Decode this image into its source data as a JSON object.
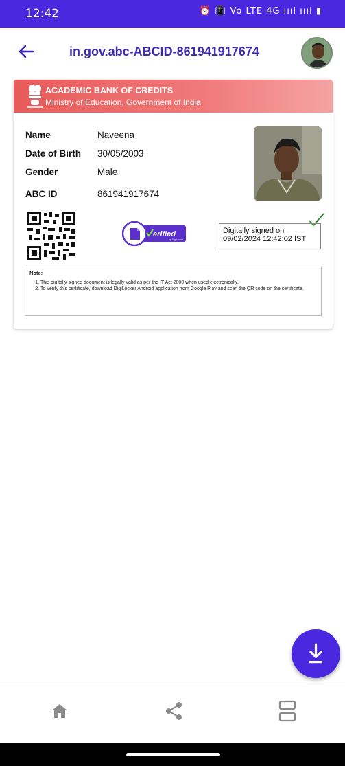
{
  "status_bar": {
    "time": "12:42",
    "indicators": "⏰ 📳 Vo LTE 4G ıııl ıııl ▮"
  },
  "app_bar": {
    "title": "in.gov.abc-ABCID-861941917674",
    "back_icon": "back-arrow-icon",
    "avatar_icon": "avatar"
  },
  "card": {
    "header_title": "ACADEMIC BANK OF CREDITS",
    "header_subtitle": "Ministry of Education, Government of India",
    "header_color": "#e85a5a",
    "fields": [
      {
        "label": "Name",
        "value": "Naveena"
      },
      {
        "label": "Date of Birth",
        "value": "30/05/2003"
      },
      {
        "label": "Gender",
        "value": "Male"
      },
      {
        "label": "ABC ID",
        "value": "861941917674"
      }
    ],
    "verified_label": "erified",
    "verified_sub": "by DigiLocker",
    "signed_line1": "Digitally signed on",
    "signed_line2": "09/02/2024 12:42:02 IST",
    "note_title": "Note:",
    "notes": [
      "This digitally signed document is legally valid as per the IT Act 2000 when used electronically.",
      "To verify this certificate, download DigiLocker Android application from Google Play and scan the QR code on the certificate."
    ]
  },
  "fab": {
    "icon": "download-icon"
  },
  "bottom_nav": {
    "items": [
      "home-icon",
      "share-icon",
      "view-toggle-icon"
    ]
  },
  "colors": {
    "primary": "#4a28e0",
    "title_text": "#3d2bb5",
    "check": "#2e8b2e"
  }
}
